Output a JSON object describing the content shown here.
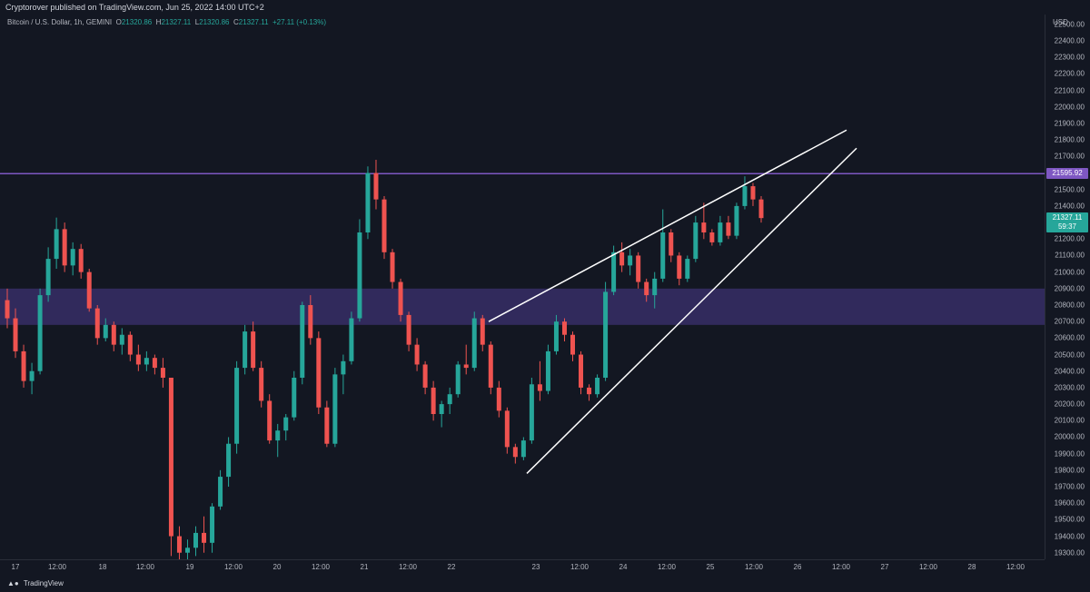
{
  "header": {
    "published_text": "Cryptorover published on TradingView.com, Jun 25, 2022 14:00 UTC+2"
  },
  "symbol": {
    "name": "Bitcoin / U.S. Dollar, 1h, GEMINI",
    "open_label": "O",
    "open": "21320.86",
    "high_label": "H",
    "high": "21327.11",
    "low_label": "L",
    "low": "21320.86",
    "close_label": "C",
    "close": "21327.11",
    "change": "+27.11 (+0.13%)"
  },
  "price_axis": {
    "currency": "USD",
    "ticks": [
      "22500.00",
      "22400.00",
      "22300.00",
      "22200.00",
      "22100.00",
      "22000.00",
      "21900.00",
      "21800.00",
      "21700.00",
      "21600.00",
      "21500.00",
      "21400.00",
      "21300.00",
      "21200.00",
      "21100.00",
      "21000.00",
      "20900.00",
      "20800.00",
      "20700.00",
      "20600.00",
      "20500.00",
      "20400.00",
      "20300.00",
      "20200.00",
      "20100.00",
      "20000.00",
      "19900.00",
      "19800.00",
      "19700.00",
      "19600.00",
      "19500.00",
      "19400.00",
      "19300.00"
    ],
    "horizontal_level": "21595.92",
    "last_price": "21327.11",
    "countdown": "59:37"
  },
  "time_axis": {
    "ticks": [
      "17",
      "12:00",
      "18",
      "12:00",
      "19",
      "12:00",
      "20",
      "12:00",
      "21",
      "12:00",
      "22",
      "23",
      "12:00",
      "24",
      "12:00",
      "25",
      "12:00",
      "26",
      "12:00",
      "27",
      "12:00",
      "28",
      "12:00"
    ]
  },
  "footer": {
    "brand": "TradingView"
  },
  "colors": {
    "background": "#131722",
    "up": "#26a69a",
    "down": "#ef5350",
    "level_line": "#7e57c2",
    "zone": "#4a3a8c",
    "trendline": "#ffffff"
  },
  "chart_data": {
    "type": "candlestick",
    "y_range": [
      19260,
      22560
    ],
    "horizontal_line": 21595.92,
    "zone": [
      20680,
      20900
    ],
    "ohlc": [
      [
        20830,
        20900,
        20660,
        20720
      ],
      [
        20720,
        20780,
        20480,
        20520
      ],
      [
        20520,
        20560,
        20300,
        20340
      ],
      [
        20340,
        20450,
        20260,
        20400
      ],
      [
        20400,
        20900,
        20380,
        20860
      ],
      [
        20860,
        21150,
        20820,
        21080
      ],
      [
        21080,
        21330,
        21020,
        21260
      ],
      [
        21260,
        21300,
        21000,
        21040
      ],
      [
        21040,
        21180,
        20980,
        21140
      ],
      [
        21140,
        21170,
        20960,
        21000
      ],
      [
        21000,
        21020,
        20760,
        20780
      ],
      [
        20780,
        20800,
        20560,
        20600
      ],
      [
        20600,
        20720,
        20580,
        20680
      ],
      [
        20680,
        20700,
        20520,
        20560
      ],
      [
        20560,
        20660,
        20500,
        20620
      ],
      [
        20620,
        20640,
        20460,
        20500
      ],
      [
        20500,
        20560,
        20400,
        20440
      ],
      [
        20440,
        20520,
        20400,
        20480
      ],
      [
        20480,
        20500,
        20380,
        20420
      ],
      [
        20420,
        20480,
        20300,
        20360
      ],
      [
        20360,
        19640,
        19280,
        19400
      ],
      [
        19400,
        19460,
        19260,
        19300
      ],
      [
        19300,
        19380,
        19260,
        19330
      ],
      [
        19330,
        19460,
        19280,
        19420
      ],
      [
        19420,
        19520,
        19300,
        19360
      ],
      [
        19360,
        19600,
        19300,
        19580
      ],
      [
        19580,
        19800,
        19560,
        19760
      ],
      [
        19760,
        20000,
        19700,
        19960
      ],
      [
        19960,
        20460,
        19900,
        20420
      ],
      [
        20420,
        20680,
        20380,
        20640
      ],
      [
        20640,
        20700,
        20400,
        20420
      ],
      [
        20420,
        20460,
        20180,
        20220
      ],
      [
        20220,
        20260,
        19960,
        19980
      ],
      [
        19980,
        20080,
        19880,
        20040
      ],
      [
        20040,
        20140,
        19980,
        20120
      ],
      [
        20120,
        20400,
        20100,
        20360
      ],
      [
        20360,
        20820,
        20320,
        20800
      ],
      [
        20800,
        20860,
        20560,
        20600
      ],
      [
        20600,
        20640,
        20140,
        20180
      ],
      [
        20180,
        20220,
        19940,
        19960
      ],
      [
        19960,
        20420,
        19940,
        20380
      ],
      [
        20380,
        20500,
        20260,
        20460
      ],
      [
        20460,
        20760,
        20440,
        20720
      ],
      [
        20720,
        21320,
        20700,
        21240
      ],
      [
        21240,
        21640,
        21200,
        21600
      ],
      [
        21600,
        21680,
        21380,
        21440
      ],
      [
        21440,
        21460,
        21080,
        21120
      ],
      [
        21120,
        21140,
        20900,
        20940
      ],
      [
        20940,
        20960,
        20700,
        20740
      ],
      [
        20740,
        20760,
        20520,
        20560
      ],
      [
        20560,
        20600,
        20400,
        20440
      ],
      [
        20440,
        20460,
        20260,
        20300
      ],
      [
        20300,
        20340,
        20100,
        20140
      ],
      [
        20140,
        20220,
        20060,
        20200
      ],
      [
        20200,
        20300,
        20140,
        20260
      ],
      [
        20260,
        20460,
        20240,
        20440
      ],
      [
        20440,
        20560,
        20380,
        20420
      ],
      [
        20420,
        20760,
        20400,
        20720
      ],
      [
        20720,
        20740,
        20520,
        20560
      ],
      [
        20560,
        20580,
        20260,
        20300
      ],
      [
        20300,
        20340,
        20120,
        20160
      ],
      [
        20160,
        20180,
        19900,
        19940
      ],
      [
        19940,
        19960,
        19840,
        19880
      ],
      [
        19880,
        20000,
        19860,
        19980
      ],
      [
        19980,
        20360,
        19960,
        20320
      ],
      [
        20320,
        20460,
        20220,
        20280
      ],
      [
        20280,
        20560,
        20260,
        20520
      ],
      [
        20520,
        20740,
        20500,
        20700
      ],
      [
        20700,
        20720,
        20580,
        20620
      ],
      [
        20620,
        20640,
        20460,
        20500
      ],
      [
        20500,
        20520,
        20260,
        20300
      ],
      [
        20300,
        20320,
        20220,
        20260
      ],
      [
        20260,
        20380,
        20240,
        20360
      ],
      [
        20360,
        20940,
        20340,
        20880
      ],
      [
        20880,
        21160,
        20860,
        21120
      ],
      [
        21120,
        21180,
        21000,
        21040
      ],
      [
        21040,
        21140,
        20980,
        21100
      ],
      [
        21100,
        21120,
        20900,
        20940
      ],
      [
        20940,
        20960,
        20820,
        20860
      ],
      [
        20860,
        21000,
        20780,
        20960
      ],
      [
        20960,
        21380,
        20940,
        21240
      ],
      [
        21240,
        21260,
        21060,
        21100
      ],
      [
        21100,
        21120,
        20920,
        20960
      ],
      [
        20960,
        21100,
        20940,
        21080
      ],
      [
        21080,
        21340,
        21060,
        21300
      ],
      [
        21300,
        21420,
        21200,
        21240
      ],
      [
        21240,
        21260,
        21160,
        21180
      ],
      [
        21180,
        21340,
        21160,
        21300
      ],
      [
        21300,
        21340,
        21200,
        21220
      ],
      [
        21220,
        21420,
        21200,
        21400
      ],
      [
        21400,
        21580,
        21380,
        21520
      ],
      [
        21520,
        21540,
        21400,
        21440
      ],
      [
        21440,
        21460,
        21300,
        21327.11
      ]
    ],
    "trendlines": [
      {
        "from": [
          "22 ~06:00",
          20700
        ],
        "to": [
          "26 ~12:00",
          21860
        ]
      },
      {
        "from": [
          "23 ~00:00",
          19780
        ],
        "to": [
          "26 ~18:00",
          21750
        ]
      }
    ]
  }
}
